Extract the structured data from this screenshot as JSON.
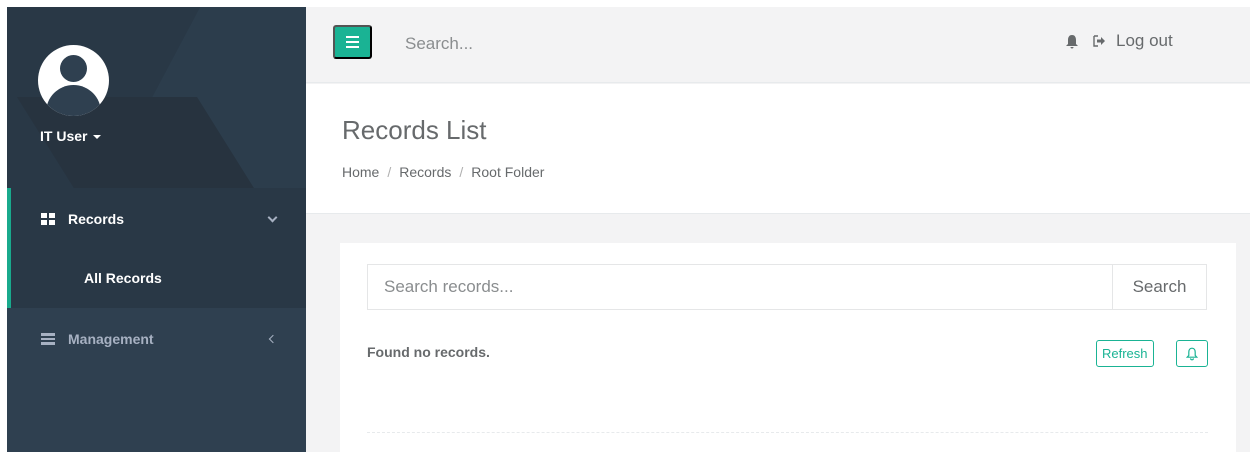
{
  "user": {
    "name": "IT User"
  },
  "sidebar": {
    "items": [
      {
        "label": "Records",
        "icon": "grid-icon",
        "expanded": true,
        "children": [
          {
            "label": "All Records"
          }
        ]
      },
      {
        "label": "Management",
        "icon": "server-icon",
        "expanded": false
      }
    ]
  },
  "topbar": {
    "search_placeholder": "Search...",
    "logout_label": "Log out",
    "icons": [
      "menu-icon",
      "bell-icon",
      "sign-out-icon"
    ]
  },
  "page": {
    "title": "Records List",
    "breadcrumb": [
      "Home",
      "Records",
      "Root Folder"
    ],
    "breadcrumb_separator": "/"
  },
  "records": {
    "search_placeholder": "Search records...",
    "search_button": "Search",
    "status": "Found no records.",
    "refresh_button": "Refresh"
  },
  "colors": {
    "sidebar": "#2f4050",
    "sidebar_active": "#293846",
    "accent": "#1ab394",
    "background": "#f3f3f4"
  }
}
